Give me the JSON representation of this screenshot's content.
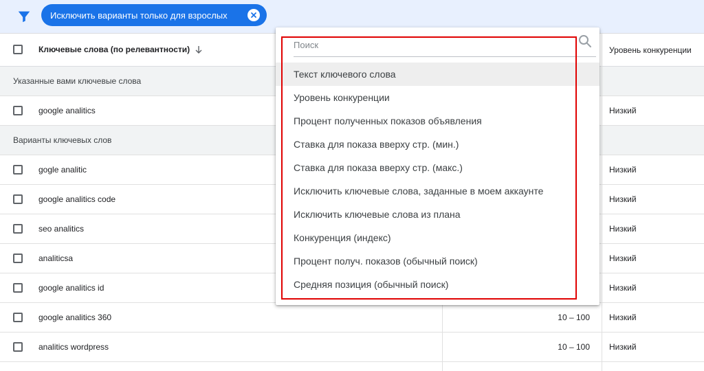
{
  "filter_bar": {
    "chip_label": "Исключить варианты только для взрослых"
  },
  "table": {
    "header": {
      "keyword_col": "Ключевые слова (по релевантности)",
      "competition_col": "Уровень конкуренции"
    },
    "sections": [
      {
        "title": "Указанные вами ключевые слова"
      },
      {
        "title": "Варианты ключевых слов"
      }
    ],
    "user_rows": [
      {
        "keyword": "google analitics",
        "range": "",
        "competition": "Низкий"
      }
    ],
    "variant_rows": [
      {
        "keyword": "gogle analitic",
        "range": "",
        "competition": "Низкий"
      },
      {
        "keyword": "google analitics code",
        "range": "",
        "competition": "Низкий"
      },
      {
        "keyword": "seo analitics",
        "range": "",
        "competition": "Низкий"
      },
      {
        "keyword": "analiticsa",
        "range": "",
        "competition": "Низкий"
      },
      {
        "keyword": "google analitics id",
        "range": "",
        "competition": "Низкий"
      },
      {
        "keyword": "google analitics 360",
        "range": "10 – 100",
        "competition": "Низкий"
      },
      {
        "keyword": "analitics wordpress",
        "range": "10 – 100",
        "competition": "Низкий"
      }
    ]
  },
  "dropdown": {
    "search_placeholder": "Поиск",
    "options": [
      "Текст ключевого слова",
      "Уровень конкуренции",
      "Процент полученных показов объявления",
      "Ставка для показа вверху стр. (мин.)",
      "Ставка для показа вверху стр. (макс.)",
      "Исключить ключевые слова, заданные в моем аккаунте",
      "Исключить ключевые слова из плана",
      "Конкуренция (индекс)",
      "Процент получ. показов (обычный поиск)",
      "Средняя позиция (обычный поиск)"
    ]
  },
  "colors": {
    "accent": "#1a73e8",
    "highlight": "#e00000"
  },
  "icons": [
    "filter-icon",
    "close-icon",
    "sort-down-icon",
    "search-icon"
  ]
}
